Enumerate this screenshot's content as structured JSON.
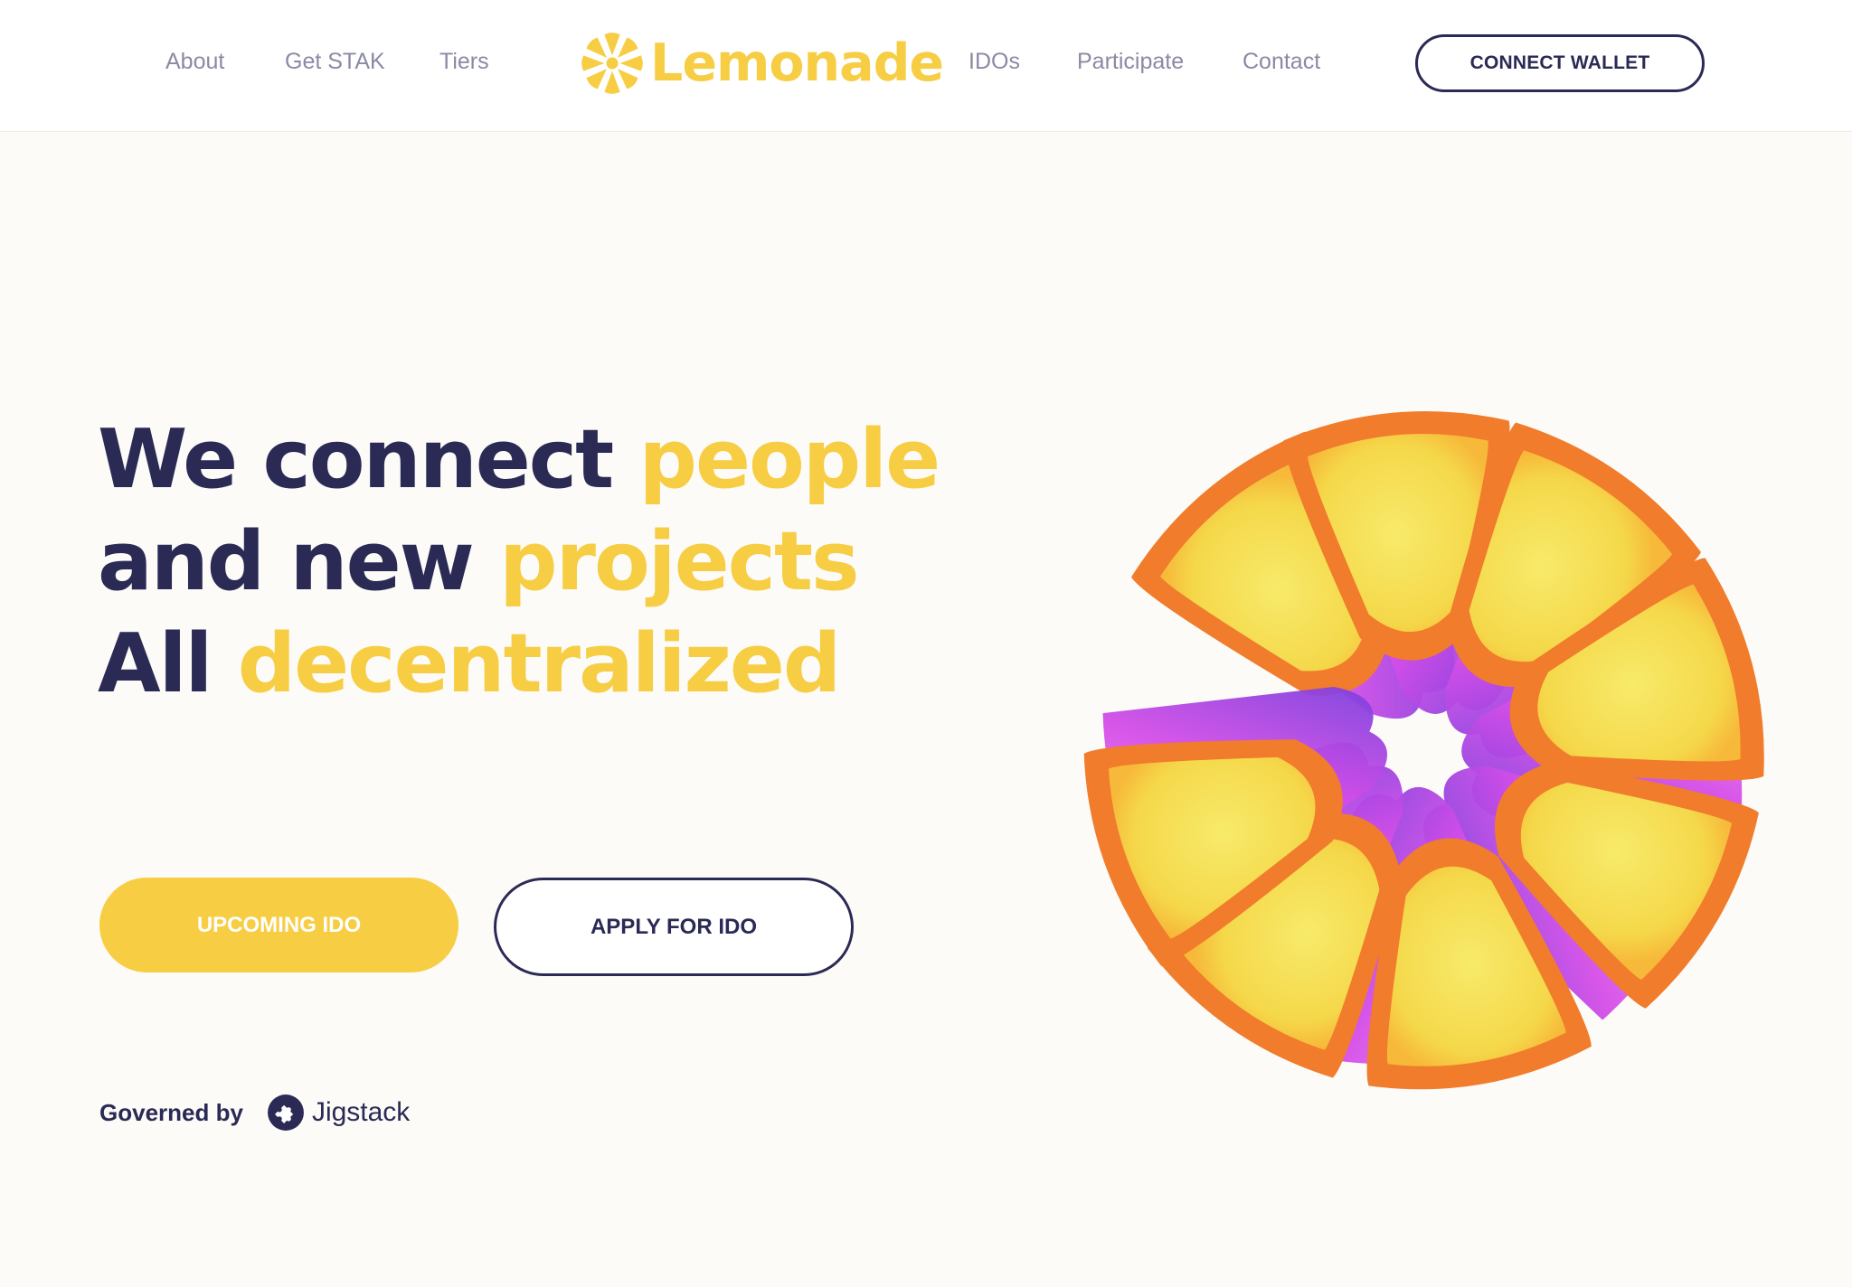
{
  "nav": {
    "left": [
      "About",
      "Get STAK",
      "Tiers"
    ],
    "right": [
      "IDOs",
      "Participate",
      "Contact"
    ],
    "logo_text": "Lemonade",
    "connect_wallet": "CONNECT WALLET"
  },
  "hero": {
    "title_line1_dark": "We connect ",
    "title_line1_accent": "people",
    "title_line2_dark": "and new ",
    "title_line2_accent": "projects",
    "title_line3_dark": "All ",
    "title_line3_accent": "decentralized",
    "primary_button": "UPCOMING IDO",
    "secondary_button": "APPLY FOR IDO",
    "governed_label": "Governed by",
    "governed_brand": "Jigstack"
  },
  "icons": {
    "logo": "lemon-slice-icon",
    "governance": "jigsaw-icon",
    "hero_art": "lemon-illustration"
  },
  "colors": {
    "brand_yellow": "#f7cd44",
    "navy": "#2a2a55",
    "nav_gray": "#8a8aa4",
    "background": "#fcfbf8",
    "orange": "#f07c2c",
    "magenta": "#d64ee8",
    "indigo": "#5a3bd9"
  }
}
